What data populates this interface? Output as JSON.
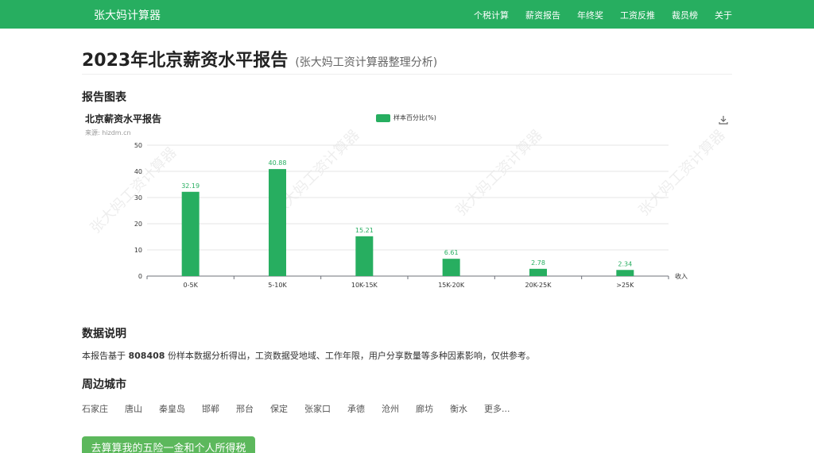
{
  "navbar": {
    "brand": "张大妈计算器",
    "links": [
      "个税计算",
      "薪资报告",
      "年终奖",
      "工资反推",
      "裁员榜",
      "关于"
    ]
  },
  "page": {
    "title": "2023年北京薪资水平报告",
    "subtitle": "(张大妈工资计算器整理分析)"
  },
  "sections": {
    "chart_heading": "报告图表",
    "data_heading": "数据说明",
    "cities_heading": "周边城市"
  },
  "chart_panel": {
    "source": "来源: hizdm.cn",
    "watermark": "张大妈工资计算器"
  },
  "chart_data": {
    "type": "bar",
    "title": "北京薪资水平报告",
    "categories": [
      "0-5K",
      "5-10K",
      "10K-15K",
      "15K-20K",
      "20K-25K",
      ">25K"
    ],
    "series": [
      {
        "name": "样本百分比(%)",
        "values": [
          32.19,
          40.88,
          15.21,
          6.61,
          2.78,
          2.34
        ]
      }
    ],
    "xlabel": "收入",
    "ylabel": "",
    "ylim": [
      0,
      50
    ],
    "yticks": [
      0,
      10,
      20,
      30,
      40,
      50
    ],
    "grid": true,
    "legend": "top-center",
    "color": "#27ae60"
  },
  "description": {
    "prefix": "本报告基于",
    "count": "808408",
    "suffix": "份样本数据分析得出，工资数据受地域、工作年限，用户分享数量等多种因素影响，仅供参考。"
  },
  "cities": [
    "石家庄",
    "唐山",
    "秦皇岛",
    "邯郸",
    "邢台",
    "保定",
    "张家口",
    "承德",
    "沧州",
    "廊坊",
    "衡水",
    "更多..."
  ],
  "cta": {
    "label": "去算算我的五险一金和个人所得税"
  },
  "colors": {
    "accent": "#27ae60",
    "button": "#5cb85c"
  }
}
